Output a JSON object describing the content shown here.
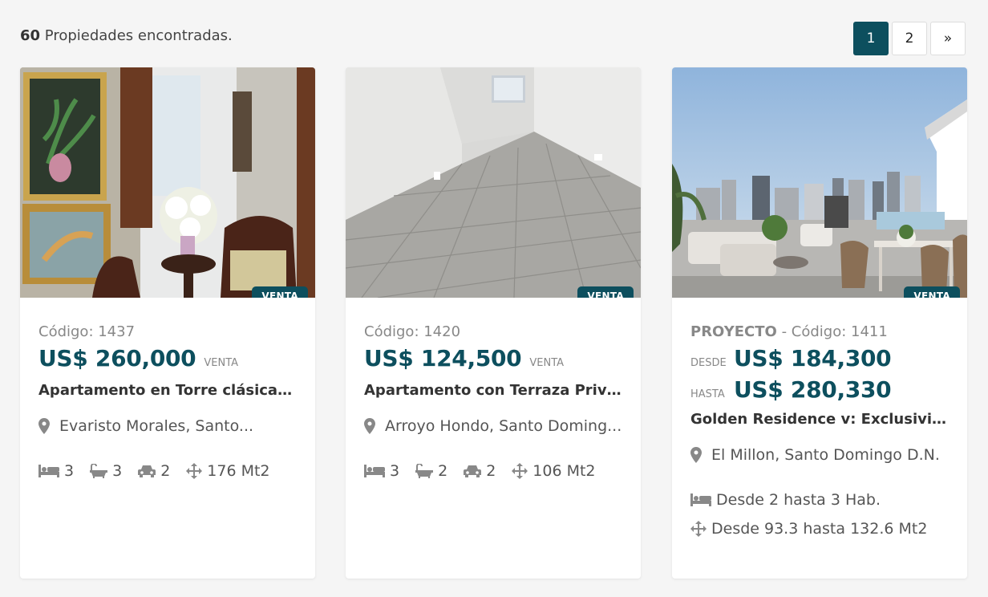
{
  "header": {
    "count": "60",
    "count_label": "Propiedades encontradas."
  },
  "pagination": {
    "pages": [
      "1",
      "2"
    ],
    "next": "»",
    "active": "1"
  },
  "cards": [
    {
      "badge": "VENTA",
      "code": "Código: 1437",
      "price": "US$ 260,000",
      "price_tag": "VENTA",
      "title": "Apartamento en Torre clásica d...",
      "location": "Evaristo Morales, Santo...",
      "beds": "3",
      "baths": "3",
      "parking": "2",
      "area": "176 Mt2"
    },
    {
      "badge": "VENTA",
      "code": "Código: 1420",
      "price": "US$ 124,500",
      "price_tag": "VENTA",
      "title": "Apartamento con Terraza Priva...",
      "location": "Arroyo Hondo, Santo Doming...",
      "beds": "3",
      "baths": "2",
      "parking": "2",
      "area": "106 Mt2"
    },
    {
      "badge": "VENTA",
      "project": "PROYECTO",
      "code": "- Código: 1411",
      "from_label": "DESDE",
      "price_from": "US$ 184,300",
      "to_label": "HASTA",
      "price_to": "US$ 280,330",
      "title": "Golden Residence v: Exclusivida...",
      "location": "El Millon, Santo Domingo D.N.",
      "rooms_range": "Desde 2 hasta 3 Hab.",
      "area_range": "Desde 93.3 hasta 132.6 Mt2"
    }
  ],
  "colors": {
    "accent": "#0d4f5e",
    "muted": "#888888",
    "background": "#f5f5f5"
  }
}
